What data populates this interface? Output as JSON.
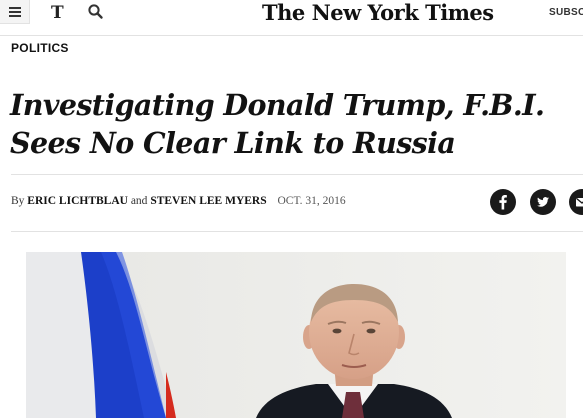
{
  "header": {
    "menu_icon": "hamburger-menu-icon",
    "t_logo_icon": "nyt-t-logo-icon",
    "search_icon": "search-icon",
    "masthead": "The New York Times",
    "subscribe_label": "SUBSC"
  },
  "article": {
    "section": "POLITICS",
    "headline_line1": "Investigating Donald Trump, F.B.I.",
    "headline_line2": "Sees No Clear Link to Russia",
    "byline": {
      "by": "By",
      "author1": "ERIC LICHTBLAU",
      "and": "and",
      "author2": "STEVEN LEE MYERS",
      "date": "OCT. 31, 2016"
    },
    "share": {
      "facebook_icon": "facebook-icon",
      "twitter_icon": "twitter-icon",
      "email_icon": "email-icon"
    },
    "photo": {
      "subject": "man in suit in front of white-blue-red flag"
    }
  },
  "colors": {
    "text": "#121212",
    "rule": "#e2e2e2",
    "share_bg": "#1a1a1a",
    "flag_blue": "#1c3fc9",
    "flag_red": "#d52b1e"
  }
}
